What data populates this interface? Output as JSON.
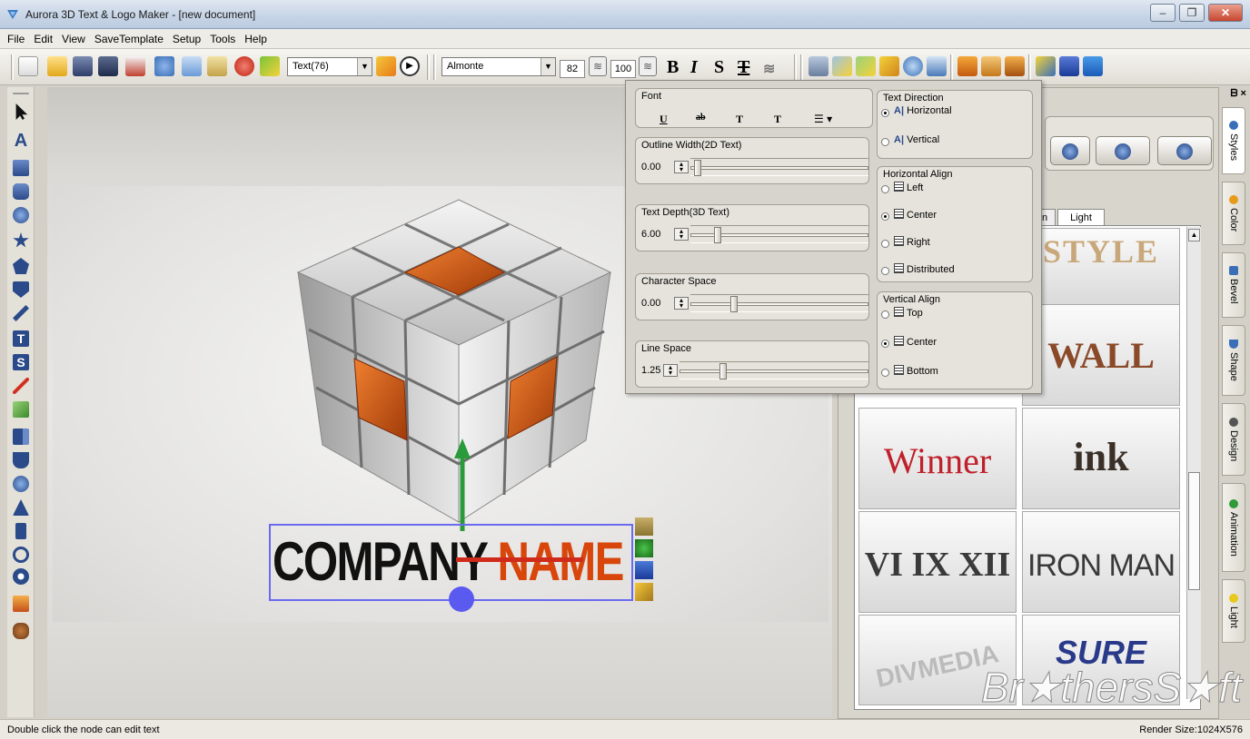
{
  "window": {
    "title": "Aurora 3D Text & Logo Maker - [new document]",
    "buttons": {
      "minimize": "–",
      "maximize": "❐",
      "close": "✕"
    }
  },
  "menu": [
    "File",
    "Edit",
    "View",
    "SaveTemplate",
    "Setup",
    "Tools",
    "Help"
  ],
  "toolbar": {
    "object_combo": "Text(76)",
    "font_combo": "Almonte",
    "font_size": "82",
    "font_scale": "100",
    "bold": "B",
    "italic": "I",
    "strike": "S",
    "special": "T",
    "combo_arrow": "▼",
    "spin_glyph": "≋",
    "play_glyph": "▶"
  },
  "canvas": {
    "text_left": "COMPANY",
    "text_right": "NAME"
  },
  "text_panel": {
    "font_group": "Font",
    "font_buttons": [
      "U",
      "ab",
      "T",
      "T",
      "☰ ▾"
    ],
    "outline_label": "Outline Width(2D Text)",
    "outline_value": "0.00",
    "depth_label": "Text Depth(3D Text)",
    "depth_value": "6.00",
    "char_space_label": "Character Space",
    "char_space_value": "0.00",
    "line_space_label": "Line Space",
    "line_space_value": "1.25",
    "direction_label": "Text Direction",
    "direction_options": [
      "Horizontal",
      "Vertical"
    ],
    "direction_glyph": "A|",
    "h_align_label": "Horizontal Align",
    "h_align_options": [
      "Left",
      "Center",
      "Right",
      "Distributed"
    ],
    "v_align_label": "Vertical Align",
    "v_align_options": [
      "Top",
      "Center",
      "Bottom"
    ]
  },
  "right_panel": {
    "header": "ᗷ ×",
    "tab_partial": "n",
    "tab_light": "Light",
    "gallery": [
      "STYLE",
      "WALL",
      "Winner",
      "ink",
      "VI IX XII",
      "IRON MAN",
      "DIVMEDIA",
      "SURE"
    ],
    "side_tabs": [
      "Styles",
      "Color",
      "Bevel",
      "Shape",
      "Design",
      "Animation",
      "Light"
    ],
    "side_tab_colors": [
      "#3a6fb8",
      "#e89a1a",
      "#3a6fb8",
      "#3a6fb8",
      "#555555",
      "#2e9a3a",
      "#e8c81a"
    ]
  },
  "watermark": "Br★thersS★ft",
  "status": {
    "left": "Double click the node can edit text",
    "right": "Render Size:1024X576"
  }
}
